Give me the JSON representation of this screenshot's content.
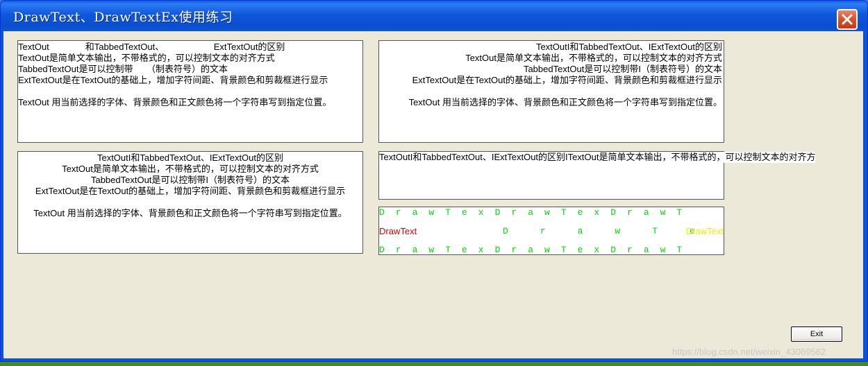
{
  "window": {
    "title": "DrawText、DrawTextEx使用练习",
    "close_label": "close"
  },
  "panel1": {
    "lines": [
      "TextOut　　　　和TabbedTextOut、　　　　　　ExtTextOut的区别",
      "TextOut是简单文本输出，不带格式的，可以控制文本的对齐方式",
      "TabbedTextOut是可以控制带　　（制表符号）的文本",
      "ExtTextOut是在TextOut的基础上，增加字符间距、背景颜色和剪裁框进行显示",
      "TextOut 用当前选择的字体、背景颜色和正文颜色将一个字符串写到指定位置。"
    ]
  },
  "panel2": {
    "lines": [
      "TextOutI和TabbedTextOut、IExtTextOut的区别",
      "TextOut是简单文本输出，不带格式的，可以控制文本的对齐方式",
      "TabbedTextOut是可以控制带I（制表符号）的文本",
      "ExtTextOut是在TextOut的基础上，增加字符间距、背景颜色和剪裁框进行显示",
      "TextOut 用当前选择的字体、背景颜色和正文颜色将一个字符串写到指定位置。"
    ]
  },
  "panel3": {
    "lines": [
      "TextOutI和TabbedTextOut、IExtTextOut的区别",
      "TextOut是简单文本输出，不带格式的，可以控制文本的对齐方式",
      "TabbedTextOut是可以控制带I（制表符号）的文本",
      "ExtTextOut是在TextOut的基础上，增加字符间距、背景颜色和剪裁框进行显示",
      "TextOut 用当前选择的字体、背景颜色和正文颜色将一个字符串写到指定位置。"
    ]
  },
  "panel4": {
    "line": "TextOutI和TabbedTextOut、IExtTextOut的区别ITextOut是简单文本输出，不带格式的，可以控制文本的对齐方"
  },
  "panel5": {
    "row1": "DrawTexDrawTexDrawT",
    "red": "DrawText",
    "row2": "DrawText",
    "yellow": "DrawText",
    "row3": "DrawTexDrawTexDrawT",
    "colors": {
      "green": "#00dd00",
      "red": "#dd0000",
      "yellow": "#eeee00"
    }
  },
  "buttons": {
    "exit": "Exit"
  },
  "watermark": "https://blog.csdn.net/weixin_43069562"
}
